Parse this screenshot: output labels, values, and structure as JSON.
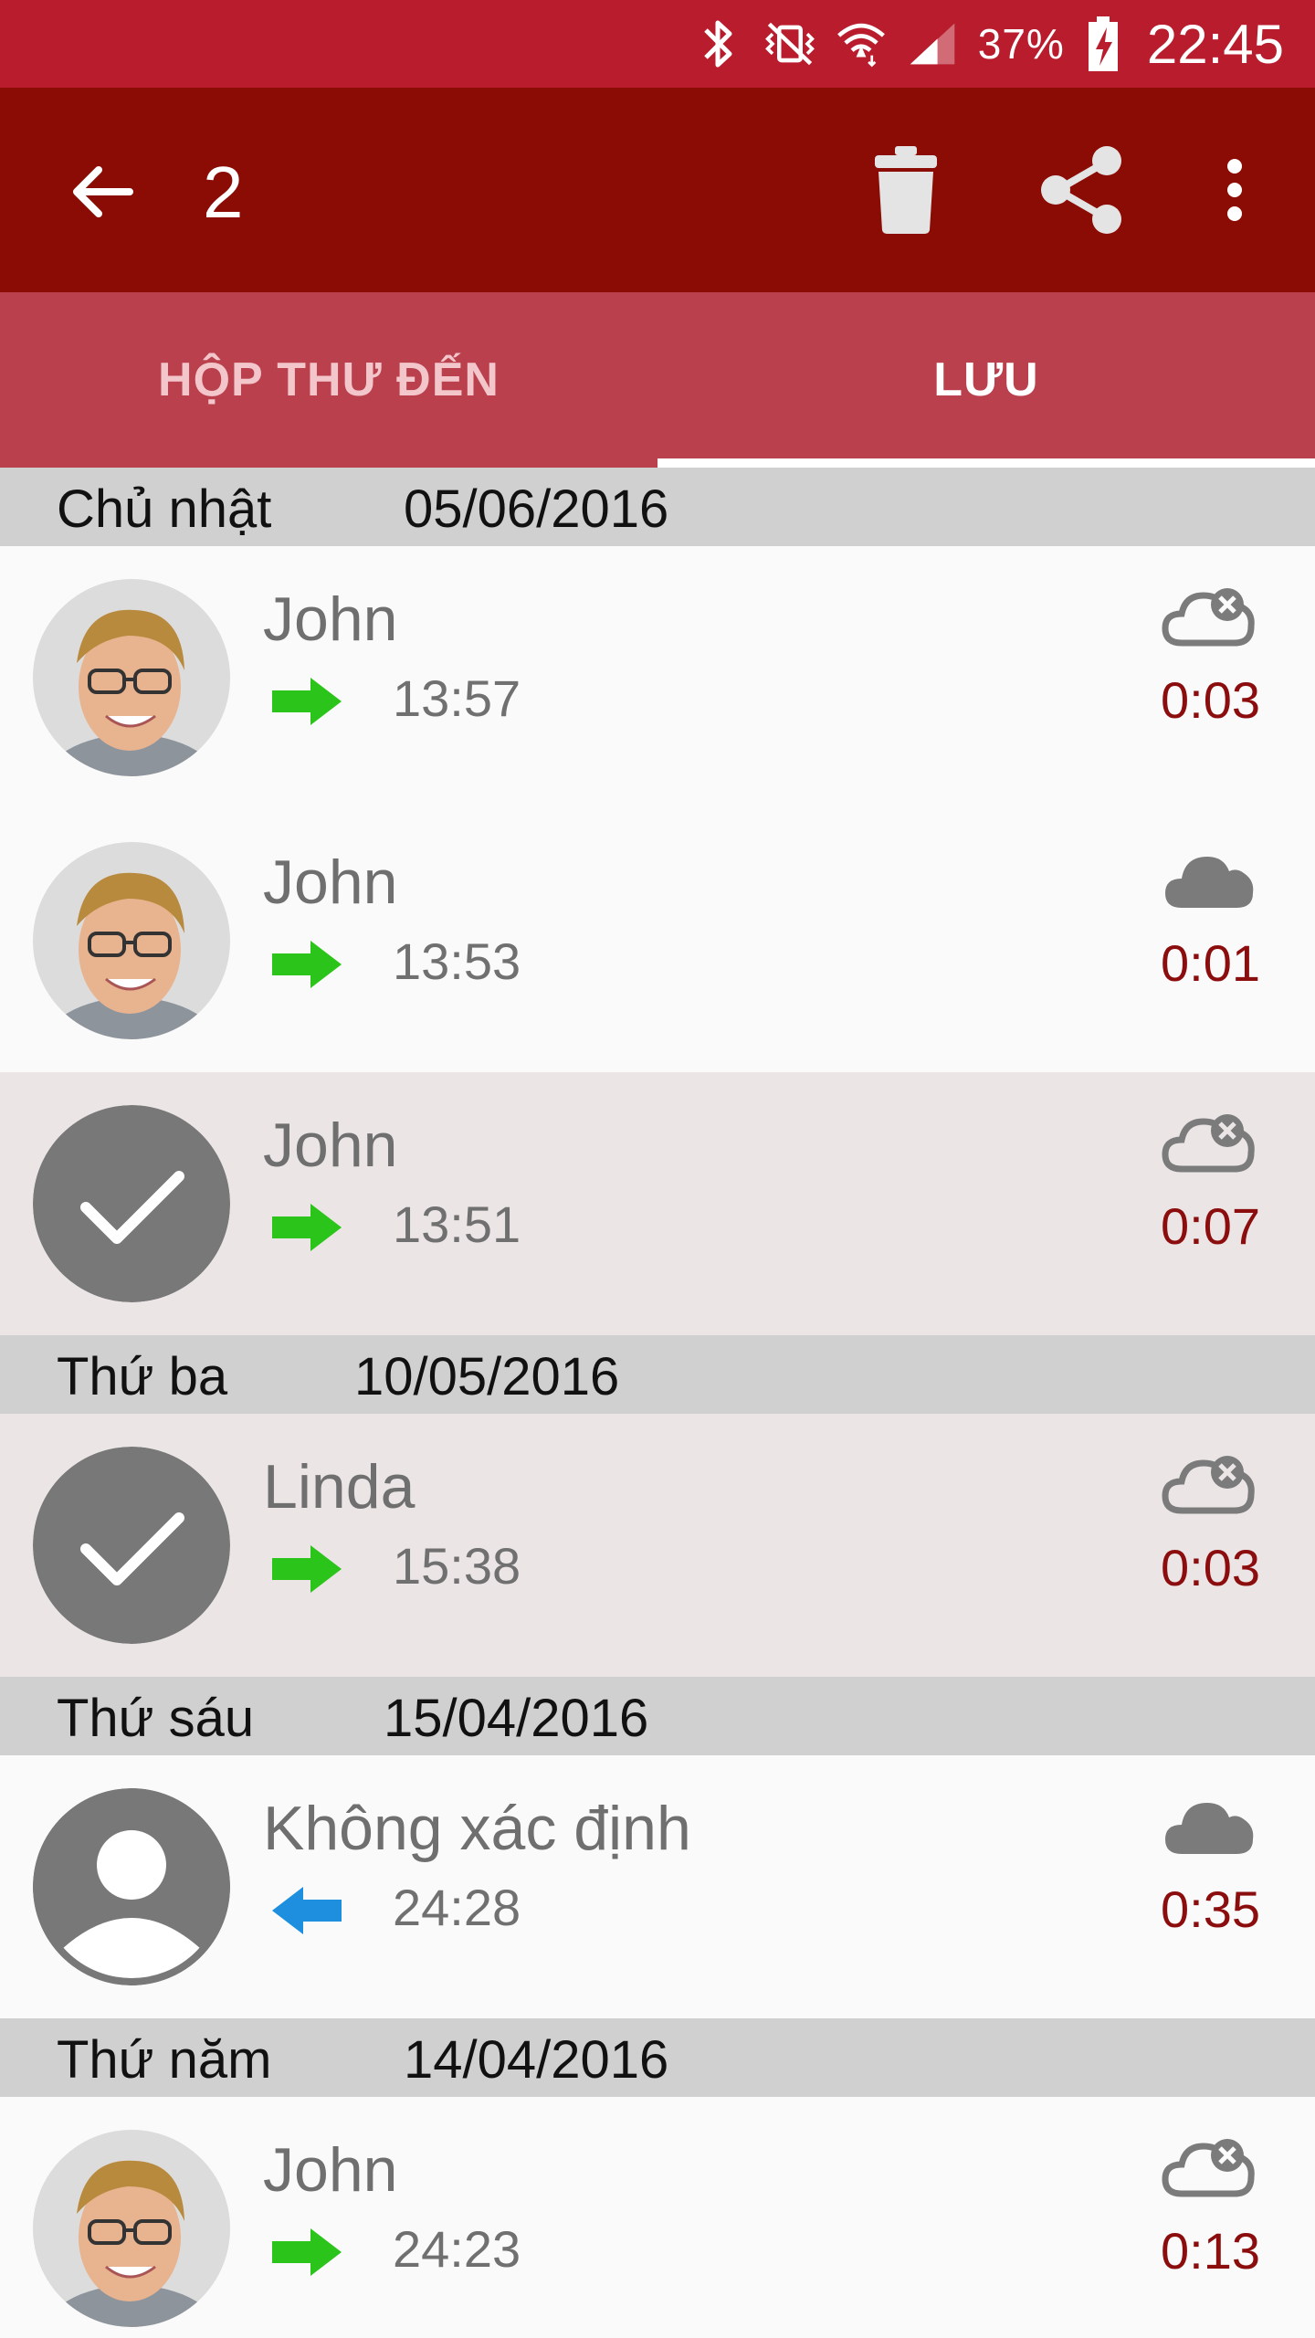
{
  "status_bar": {
    "battery_percent": "37%",
    "clock": "22:45"
  },
  "app_bar": {
    "selected_count": "2",
    "icons": [
      "arrow-back-icon",
      "trash-icon",
      "share-icon",
      "more-vert-icon"
    ]
  },
  "tabs": [
    {
      "label": "HỘP THƯ ĐẾN",
      "active": false
    },
    {
      "label": "LƯU",
      "active": true
    }
  ],
  "colors": {
    "status_bar": "#b91d2d",
    "app_bar": "#8a0c04",
    "tab_bar": "#b9404c",
    "outgoing_arrow": "#2bc41a",
    "incoming_arrow": "#1d8fde",
    "duration_text": "#8b0d0d"
  },
  "groups": [
    {
      "day": "Chủ nhật",
      "date": "05/06/2016",
      "items": [
        {
          "name": "John",
          "time": "13:57",
          "duration": "0:03",
          "direction": "outgoing",
          "cloud": "cloud-off-icon",
          "selected": false,
          "avatar": "photo"
        },
        {
          "name": "John",
          "time": "13:53",
          "duration": "0:01",
          "direction": "outgoing",
          "cloud": "cloud-icon",
          "selected": false,
          "avatar": "photo"
        },
        {
          "name": "John",
          "time": "13:51",
          "duration": "0:07",
          "direction": "outgoing",
          "cloud": "cloud-off-icon",
          "selected": true,
          "avatar": "check"
        }
      ]
    },
    {
      "day": "Thứ ba",
      "date": "10/05/2016",
      "items": [
        {
          "name": "Linda",
          "time": "15:38",
          "duration": "0:03",
          "direction": "outgoing",
          "cloud": "cloud-off-icon",
          "selected": true,
          "avatar": "check"
        }
      ]
    },
    {
      "day": "Thứ sáu",
      "date": "15/04/2016",
      "items": [
        {
          "name": "Không xác định",
          "time": "24:28",
          "duration": "0:35",
          "direction": "incoming",
          "cloud": "cloud-icon",
          "selected": false,
          "avatar": "person"
        }
      ]
    },
    {
      "day": "Thứ năm",
      "date": "14/04/2016",
      "items": [
        {
          "name": "John",
          "time": "24:23",
          "duration": "0:13",
          "direction": "outgoing",
          "cloud": "cloud-off-icon",
          "selected": false,
          "avatar": "photo"
        }
      ]
    }
  ]
}
